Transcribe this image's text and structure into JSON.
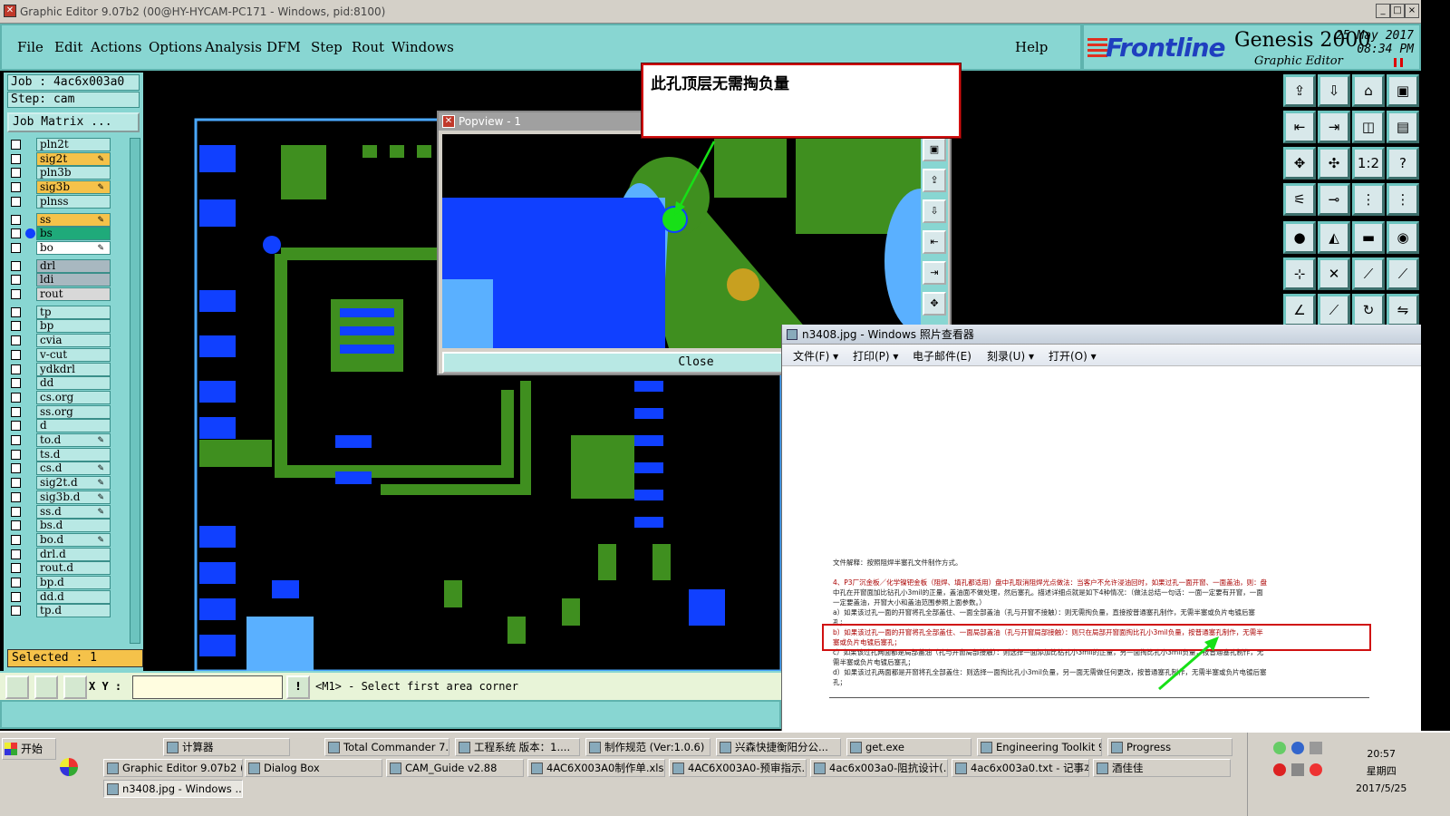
{
  "titlebar": {
    "title": "Graphic Editor 9.07b2 (00@HY-HYCAM-PC171 - Windows, pid:8100)",
    "min": "_",
    "max": "□",
    "close": "×"
  },
  "menu": {
    "items": [
      "File",
      "Edit",
      "Actions",
      "Options",
      "Analysis",
      "DFM",
      "Step",
      "Rout",
      "Windows"
    ],
    "help": "Help"
  },
  "brand": {
    "logo": "Frontline",
    "product": "Genesis 2000",
    "subtitle": "Graphic Editor",
    "date": "25 May 2017",
    "time": "08:34 PM"
  },
  "job": {
    "job_line": "Job : 4ac6x003a0",
    "step_line": "Step: cam",
    "matrix_label": "Job Matrix ...",
    "selected": "Selected : 1"
  },
  "layers": [
    {
      "name": "pln2t",
      "color": "#b8e8e4"
    },
    {
      "name": "sig2t",
      "color": "#f5c24a",
      "edit": true
    },
    {
      "name": "pln3b",
      "color": "#b8e8e4"
    },
    {
      "name": "sig3b",
      "color": "#f5c24a",
      "edit": true
    },
    {
      "name": "plnss",
      "color": "#b8e8e4"
    },
    {
      "name": "ss",
      "color": "#f5c24a",
      "edit": true,
      "gap": true
    },
    {
      "name": "bs",
      "color": "#1faa7a",
      "dot": true
    },
    {
      "name": "bo",
      "color": "#ffffff",
      "edit": true
    },
    {
      "name": "drl",
      "color": "#a8b8c0",
      "gap": true
    },
    {
      "name": "ldi",
      "color": "#a8b8c0"
    },
    {
      "name": "rout",
      "color": "#d8d8d8"
    },
    {
      "name": "tp",
      "color": "#b8e8e4",
      "gap": true
    },
    {
      "name": "bp",
      "color": "#b8e8e4"
    },
    {
      "name": "cvia",
      "color": "#b8e8e4"
    },
    {
      "name": "v-cut",
      "color": "#b8e8e4"
    },
    {
      "name": "ydkdrl",
      "color": "#b8e8e4"
    },
    {
      "name": "dd",
      "color": "#b8e8e4"
    },
    {
      "name": "cs.org",
      "color": "#b8e8e4"
    },
    {
      "name": "ss.org",
      "color": "#b8e8e4"
    },
    {
      "name": "d",
      "color": "#b8e8e4"
    },
    {
      "name": "to.d",
      "color": "#b8e8e4",
      "edit": true
    },
    {
      "name": "ts.d",
      "color": "#b8e8e4"
    },
    {
      "name": "cs.d",
      "color": "#b8e8e4",
      "edit": true
    },
    {
      "name": "sig2t.d",
      "color": "#b8e8e4",
      "edit": true
    },
    {
      "name": "sig3b.d",
      "color": "#b8e8e4",
      "edit": true
    },
    {
      "name": "ss.d",
      "color": "#b8e8e4",
      "edit": true
    },
    {
      "name": "bs.d",
      "color": "#b8e8e4"
    },
    {
      "name": "bo.d",
      "color": "#b8e8e4",
      "edit": true
    },
    {
      "name": "drl.d",
      "color": "#b8e8e4"
    },
    {
      "name": "rout.d",
      "color": "#b8e8e4"
    },
    {
      "name": "bp.d",
      "color": "#b8e8e4"
    },
    {
      "name": "dd.d",
      "color": "#b8e8e4"
    },
    {
      "name": "tp.d",
      "color": "#b8e8e4"
    }
  ],
  "cmdbar": {
    "xy_label": "X Y :",
    "xy_value": "",
    "message": "<M1> - Select first area corner",
    "info_btn": "!"
  },
  "popview": {
    "title": "Popview - 1",
    "close_label": "Close"
  },
  "callout": {
    "text": "此孔顶层无需掏负量"
  },
  "photoviewer": {
    "title": "n3408.jpg - Windows 照片查看器",
    "menu": [
      "文件(F) ▾",
      "打印(P) ▾",
      "电子邮件(E)",
      "刻录(U) ▾",
      "打开(O) ▾"
    ],
    "doc_lines": [
      "文件解释：按照阻焊半塞孔文件制作方式。",
      "4、P3厂沉金板／化学镍钯金板（阻焊、填孔都适用）盘中孔取消阻焊光点做法：当客户不允许浸油回时，如果过孔一面开窗、一面盖油，则：盘",
      "中孔在开窗面加比钻孔小3mil的正量，盖油面不做处理，然后塞孔。描述详细点就是如下4种情况：（做法总结一句话：一面一定要有开窗，一面",
      "一定要盖油，开窗大小和盖油范围参照上面参数。）",
      "a）如果该过孔一面的开窗将孔全部盖住、一面全部盖油（孔与开窗不接触）：则无需掏负量，直接按普通塞孔制作，无需半塞或负片电镀后塞",
      "孔；",
      "b）如果该过孔一面的开窗将孔全部盖住、一面局部盖油（孔与开窗局部接触）：则只在局部开窗面掏比孔小3mil负量，按普通塞孔制作，无需半",
      "塞或负片电镀后塞孔；",
      "c）如果该过孔两面都是局部盖油（孔与开窗局部接触）：则选择一面添加比钻孔小3mil的正量，另一面掏比孔小3mil负量，按普通塞孔制作，无",
      "需半塞或负片电镀后塞孔；",
      "d）如果该过孔两面都是开窗将孔全部盖住：则选择一面掏比孔小3mil负量，另一面无需做任何更改，按普通塞孔制作，无需半塞或负片电镀后塞",
      "孔；"
    ]
  },
  "taskbar": {
    "start": "开始",
    "row1": [
      "计算器",
      "Total Commander 7.0...",
      "工程系统  版本：1....",
      "制作规范 (Ver:1.0.6)",
      "兴森快捷衡阳分公...",
      "get.exe",
      "Engineering Toolkit 9....",
      "Progress"
    ],
    "row2": [
      "Graphic Editor 9.07b2 (0...",
      "Dialog Box",
      "CAM_Guide v2.88",
      "4AC6X003A0制作单.xls...",
      "4AC6X003A0-预审指示...",
      "4ac6x003a0-阻抗设计(...",
      "4ac6x003a0.txt - 记事本",
      "酒佳佳"
    ],
    "row3": [
      "n3408.jpg - Windows ..."
    ],
    "clock_time": "20:57",
    "clock_day": "星期四",
    "clock_date": "2017/5/25"
  }
}
